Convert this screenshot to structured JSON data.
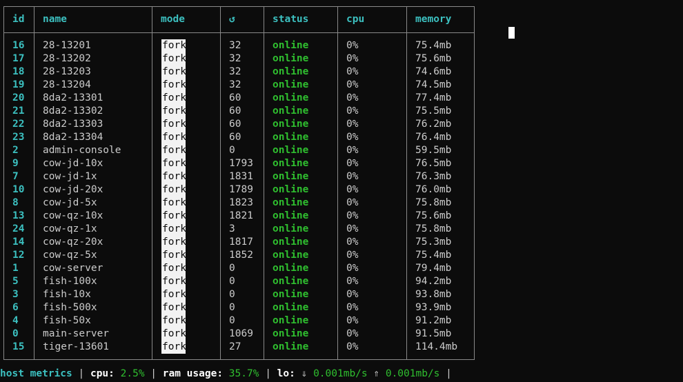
{
  "columns": {
    "id": "id",
    "name": "name",
    "mode": "mode",
    "restart": "↺",
    "status": "status",
    "cpu": "cpu",
    "memory": "memory"
  },
  "rows": [
    {
      "id": "16",
      "name": "28-13201",
      "mode": "fork",
      "restarts": "32",
      "status": "online",
      "cpu": "0%",
      "memory": "75.4mb"
    },
    {
      "id": "17",
      "name": "28-13202",
      "mode": "fork",
      "restarts": "32",
      "status": "online",
      "cpu": "0%",
      "memory": "75.6mb"
    },
    {
      "id": "18",
      "name": "28-13203",
      "mode": "fork",
      "restarts": "32",
      "status": "online",
      "cpu": "0%",
      "memory": "74.6mb"
    },
    {
      "id": "19",
      "name": "28-13204",
      "mode": "fork",
      "restarts": "32",
      "status": "online",
      "cpu": "0%",
      "memory": "74.5mb"
    },
    {
      "id": "20",
      "name": "8da2-13301",
      "mode": "fork",
      "restarts": "60",
      "status": "online",
      "cpu": "0%",
      "memory": "77.4mb"
    },
    {
      "id": "21",
      "name": "8da2-13302",
      "mode": "fork",
      "restarts": "60",
      "status": "online",
      "cpu": "0%",
      "memory": "75.5mb"
    },
    {
      "id": "22",
      "name": "8da2-13303",
      "mode": "fork",
      "restarts": "60",
      "status": "online",
      "cpu": "0%",
      "memory": "76.2mb"
    },
    {
      "id": "23",
      "name": "8da2-13304",
      "mode": "fork",
      "restarts": "60",
      "status": "online",
      "cpu": "0%",
      "memory": "76.4mb"
    },
    {
      "id": "2",
      "name": "admin-console",
      "mode": "fork",
      "restarts": "0",
      "status": "online",
      "cpu": "0%",
      "memory": "59.5mb"
    },
    {
      "id": "9",
      "name": "cow-jd-10x",
      "mode": "fork",
      "restarts": "1793",
      "status": "online",
      "cpu": "0%",
      "memory": "76.5mb"
    },
    {
      "id": "7",
      "name": "cow-jd-1x",
      "mode": "fork",
      "restarts": "1831",
      "status": "online",
      "cpu": "0%",
      "memory": "76.3mb"
    },
    {
      "id": "10",
      "name": "cow-jd-20x",
      "mode": "fork",
      "restarts": "1789",
      "status": "online",
      "cpu": "0%",
      "memory": "76.0mb"
    },
    {
      "id": "8",
      "name": "cow-jd-5x",
      "mode": "fork",
      "restarts": "1823",
      "status": "online",
      "cpu": "0%",
      "memory": "75.8mb"
    },
    {
      "id": "13",
      "name": "cow-qz-10x",
      "mode": "fork",
      "restarts": "1821",
      "status": "online",
      "cpu": "0%",
      "memory": "75.6mb"
    },
    {
      "id": "24",
      "name": "cow-qz-1x",
      "mode": "fork",
      "restarts": "3",
      "status": "online",
      "cpu": "0%",
      "memory": "75.8mb"
    },
    {
      "id": "14",
      "name": "cow-qz-20x",
      "mode": "fork",
      "restarts": "1817",
      "status": "online",
      "cpu": "0%",
      "memory": "75.3mb"
    },
    {
      "id": "12",
      "name": "cow-qz-5x",
      "mode": "fork",
      "restarts": "1852",
      "status": "online",
      "cpu": "0%",
      "memory": "75.4mb"
    },
    {
      "id": "1",
      "name": "cow-server",
      "mode": "fork",
      "restarts": "0",
      "status": "online",
      "cpu": "0%",
      "memory": "79.4mb"
    },
    {
      "id": "5",
      "name": "fish-100x",
      "mode": "fork",
      "restarts": "0",
      "status": "online",
      "cpu": "0%",
      "memory": "94.2mb"
    },
    {
      "id": "3",
      "name": "fish-10x",
      "mode": "fork",
      "restarts": "0",
      "status": "online",
      "cpu": "0%",
      "memory": "93.8mb"
    },
    {
      "id": "6",
      "name": "fish-500x",
      "mode": "fork",
      "restarts": "0",
      "status": "online",
      "cpu": "0%",
      "memory": "93.9mb"
    },
    {
      "id": "4",
      "name": "fish-50x",
      "mode": "fork",
      "restarts": "0",
      "status": "online",
      "cpu": "0%",
      "memory": "91.2mb"
    },
    {
      "id": "0",
      "name": "main-server",
      "mode": "fork",
      "restarts": "1069",
      "status": "online",
      "cpu": "0%",
      "memory": "91.5mb"
    },
    {
      "id": "15",
      "name": "tiger-13601",
      "mode": "fork",
      "restarts": "27",
      "status": "online",
      "cpu": "0%",
      "memory": "114.4mb"
    }
  ],
  "footer": {
    "title": "host metrics",
    "sep": "|",
    "cpu_label": "cpu:",
    "cpu_value": "2.5%",
    "ram_label": "ram usage:",
    "ram_value": "35.7%",
    "lo_label": "lo:",
    "down_arrow": "⇓",
    "down_value": "0.001mb/s",
    "up_arrow": "⇑",
    "up_value": "0.001mb/s"
  },
  "colors": {
    "accent": "#3cc0c0",
    "online": "#2fbf2f",
    "border": "#8a8a8a",
    "background": "#0c0c0c"
  }
}
